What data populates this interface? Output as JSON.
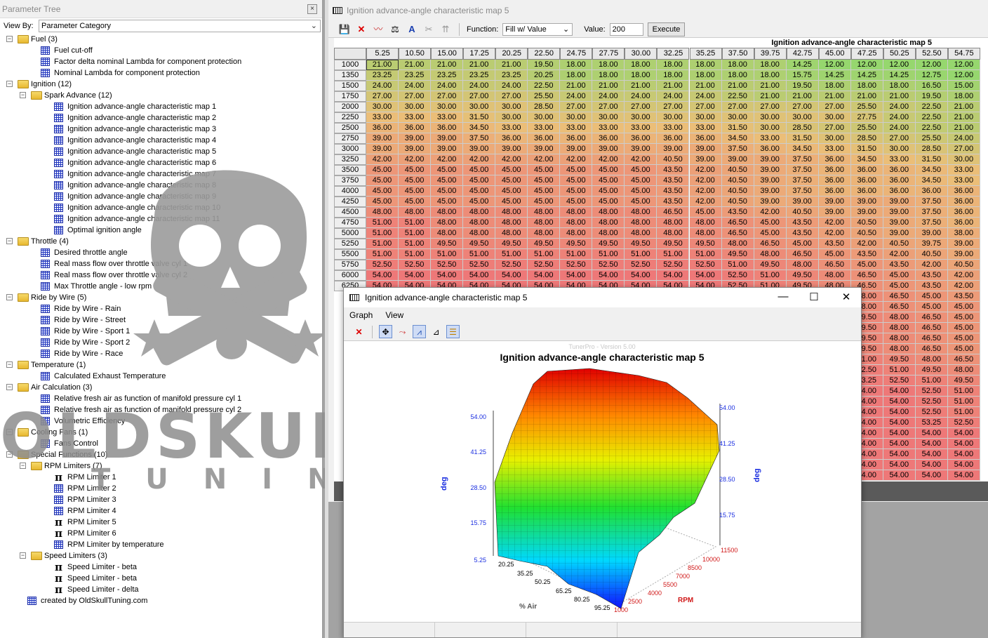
{
  "parameter_tree": {
    "title": "Parameter Tree",
    "close": "×",
    "view_by_label": "View By:",
    "view_by_value": "Parameter Category",
    "nodes": [
      {
        "label": "Fuel (3)",
        "type": "folder",
        "depth": 0
      },
      {
        "label": "Fuel cut-off",
        "type": "table",
        "depth": 1
      },
      {
        "label": "Factor delta nominal Lambda for component protection",
        "type": "table",
        "depth": 1
      },
      {
        "label": "Nominal Lambda for component protection",
        "type": "table",
        "depth": 1
      },
      {
        "label": "Ignition (12)",
        "type": "folder",
        "depth": 0
      },
      {
        "label": "Spark Advance (12)",
        "type": "folder",
        "depth": 1
      },
      {
        "label": "Ignition advance-angle characteristic map 1",
        "type": "table",
        "depth": 2
      },
      {
        "label": "Ignition advance-angle characteristic map 2",
        "type": "table",
        "depth": 2
      },
      {
        "label": "Ignition advance-angle characteristic map 3",
        "type": "table",
        "depth": 2
      },
      {
        "label": "Ignition advance-angle characteristic map 4",
        "type": "table",
        "depth": 2
      },
      {
        "label": "Ignition advance-angle characteristic map 5",
        "type": "table",
        "depth": 2
      },
      {
        "label": "Ignition advance-angle characteristic map 6",
        "type": "table",
        "depth": 2
      },
      {
        "label": "Ignition advance-angle characteristic map 7",
        "type": "table",
        "depth": 2
      },
      {
        "label": "Ignition advance-angle characteristic map 8",
        "type": "table",
        "depth": 2
      },
      {
        "label": "Ignition advance-angle characteristic map 9",
        "type": "table",
        "depth": 2
      },
      {
        "label": "Ignition advance-angle characteristic map 10",
        "type": "table",
        "depth": 2
      },
      {
        "label": "Ignition advance-angle characteristic map 11",
        "type": "table",
        "depth": 2
      },
      {
        "label": "Optimal ignition angle",
        "type": "table",
        "depth": 2
      },
      {
        "label": "Throttle (4)",
        "type": "folder",
        "depth": 0
      },
      {
        "label": "Desired throttle angle",
        "type": "table",
        "depth": 1
      },
      {
        "label": "Real mass flow over throttle valve cyl 1",
        "type": "table",
        "depth": 1
      },
      {
        "label": "Real mass flow over throttle valve cyl 2",
        "type": "table",
        "depth": 1
      },
      {
        "label": "Max Throttle angle - low rpm",
        "type": "table",
        "depth": 1
      },
      {
        "label": "Ride by Wire (5)",
        "type": "folder",
        "depth": 0
      },
      {
        "label": "Ride by Wire - Rain",
        "type": "table",
        "depth": 1
      },
      {
        "label": "Ride by Wire - Street",
        "type": "table",
        "depth": 1
      },
      {
        "label": "Ride by Wire - Sport 1",
        "type": "table",
        "depth": 1
      },
      {
        "label": "Ride by Wire - Sport 2",
        "type": "table",
        "depth": 1
      },
      {
        "label": "Ride by Wire - Race",
        "type": "table",
        "depth": 1
      },
      {
        "label": "Temperature (1)",
        "type": "folder",
        "depth": 0
      },
      {
        "label": "Calculated Exhaust Temperature",
        "type": "table",
        "depth": 1
      },
      {
        "label": "Air Calculation (3)",
        "type": "folder",
        "depth": 0
      },
      {
        "label": "Relative fresh air as function of manifold pressure cyl 1",
        "type": "table",
        "depth": 1
      },
      {
        "label": "Relative fresh air as function of manifold pressure cyl 2",
        "type": "table",
        "depth": 1
      },
      {
        "label": "Volumetric Efficiency",
        "type": "table",
        "depth": 1
      },
      {
        "label": "Cooling Fans (1)",
        "type": "folder",
        "depth": 0
      },
      {
        "label": "Fans Control",
        "type": "table",
        "depth": 1
      },
      {
        "label": "Special Functions (10)",
        "type": "folder",
        "depth": 0
      },
      {
        "label": "RPM Limiters (7)",
        "type": "folder",
        "depth": 1
      },
      {
        "label": "RPM Limiter 1",
        "type": "pi",
        "depth": 2
      },
      {
        "label": "RPM Limiter 2",
        "type": "table",
        "depth": 2
      },
      {
        "label": "RPM Limiter 3",
        "type": "table",
        "depth": 2
      },
      {
        "label": "RPM Limiter 4",
        "type": "table",
        "depth": 2
      },
      {
        "label": "RPM Limiter 5",
        "type": "pi",
        "depth": 2
      },
      {
        "label": "RPM Limiter 6",
        "type": "pi",
        "depth": 2
      },
      {
        "label": "RPM Limiter by temperature",
        "type": "table",
        "depth": 2
      },
      {
        "label": "Speed Limiters (3)",
        "type": "folder",
        "depth": 1
      },
      {
        "label": "Speed Limiter - beta",
        "type": "pi",
        "depth": 2
      },
      {
        "label": "Speed Limiter - beta",
        "type": "pi",
        "depth": 2
      },
      {
        "label": "Speed Limiter - delta",
        "type": "pi",
        "depth": 2
      },
      {
        "label": "created by OldSkullTuning.com",
        "type": "table",
        "depth": 0
      }
    ]
  },
  "watermark": {
    "line1": "OLDSKULL",
    "line2": "TUNING"
  },
  "map_window": {
    "title": "Ignition advance-angle characteristic map 5",
    "function_label": "Function:",
    "function_value": "Fill w/ Value",
    "value_label": "Value:",
    "value": "200",
    "execute_label": "Execute",
    "table_title": "Ignition advance-angle characteristic map 5",
    "columns": [
      "5.25",
      "10.50",
      "15.00",
      "17.25",
      "20.25",
      "22.50",
      "24.75",
      "27.75",
      "30.00",
      "32.25",
      "35.25",
      "37.50",
      "39.75",
      "42.75",
      "45.00",
      "47.25",
      "50.25",
      "52.50",
      "54.75"
    ],
    "rows": [
      {
        "rpm": "1000",
        "v": [
          "21.00",
          "21.00",
          "21.00",
          "21.00",
          "21.00",
          "19.50",
          "18.00",
          "18.00",
          "18.00",
          "18.00",
          "18.00",
          "18.00",
          "18.00",
          "14.25",
          "12.00",
          "12.00",
          "12.00",
          "12.00",
          "12.00"
        ]
      },
      {
        "rpm": "1350",
        "v": [
          "23.25",
          "23.25",
          "23.25",
          "23.25",
          "23.25",
          "20.25",
          "18.00",
          "18.00",
          "18.00",
          "18.00",
          "18.00",
          "18.00",
          "18.00",
          "15.75",
          "14.25",
          "14.25",
          "14.25",
          "12.75",
          "12.00"
        ]
      },
      {
        "rpm": "1500",
        "v": [
          "24.00",
          "24.00",
          "24.00",
          "24.00",
          "24.00",
          "22.50",
          "21.00",
          "21.00",
          "21.00",
          "21.00",
          "21.00",
          "21.00",
          "21.00",
          "19.50",
          "18.00",
          "18.00",
          "18.00",
          "16.50",
          "15.00"
        ]
      },
      {
        "rpm": "1750",
        "v": [
          "27.00",
          "27.00",
          "27.00",
          "27.00",
          "27.00",
          "25.50",
          "24.00",
          "24.00",
          "24.00",
          "24.00",
          "24.00",
          "22.50",
          "21.00",
          "21.00",
          "21.00",
          "21.00",
          "21.00",
          "19.50",
          "18.00"
        ]
      },
      {
        "rpm": "2000",
        "v": [
          "30.00",
          "30.00",
          "30.00",
          "30.00",
          "30.00",
          "28.50",
          "27.00",
          "27.00",
          "27.00",
          "27.00",
          "27.00",
          "27.00",
          "27.00",
          "27.00",
          "27.00",
          "25.50",
          "24.00",
          "22.50",
          "21.00"
        ]
      },
      {
        "rpm": "2250",
        "v": [
          "33.00",
          "33.00",
          "33.00",
          "31.50",
          "30.00",
          "30.00",
          "30.00",
          "30.00",
          "30.00",
          "30.00",
          "30.00",
          "30.00",
          "30.00",
          "30.00",
          "30.00",
          "27.75",
          "24.00",
          "22.50",
          "21.00"
        ]
      },
      {
        "rpm": "2500",
        "v": [
          "36.00",
          "36.00",
          "36.00",
          "34.50",
          "33.00",
          "33.00",
          "33.00",
          "33.00",
          "33.00",
          "33.00",
          "33.00",
          "31.50",
          "30.00",
          "28.50",
          "27.00",
          "25.50",
          "24.00",
          "22.50",
          "21.00"
        ]
      },
      {
        "rpm": "2750",
        "v": [
          "39.00",
          "39.00",
          "39.00",
          "37.50",
          "36.00",
          "36.00",
          "36.00",
          "36.00",
          "36.00",
          "36.00",
          "36.00",
          "34.50",
          "33.00",
          "31.50",
          "30.00",
          "28.50",
          "27.00",
          "25.50",
          "24.00"
        ]
      },
      {
        "rpm": "3000",
        "v": [
          "39.00",
          "39.00",
          "39.00",
          "39.00",
          "39.00",
          "39.00",
          "39.00",
          "39.00",
          "39.00",
          "39.00",
          "39.00",
          "37.50",
          "36.00",
          "34.50",
          "33.00",
          "31.50",
          "30.00",
          "28.50",
          "27.00"
        ]
      },
      {
        "rpm": "3250",
        "v": [
          "42.00",
          "42.00",
          "42.00",
          "42.00",
          "42.00",
          "42.00",
          "42.00",
          "42.00",
          "42.00",
          "40.50",
          "39.00",
          "39.00",
          "39.00",
          "37.50",
          "36.00",
          "34.50",
          "33.00",
          "31.50",
          "30.00"
        ]
      },
      {
        "rpm": "3500",
        "v": [
          "45.00",
          "45.00",
          "45.00",
          "45.00",
          "45.00",
          "45.00",
          "45.00",
          "45.00",
          "45.00",
          "43.50",
          "42.00",
          "40.50",
          "39.00",
          "37.50",
          "36.00",
          "36.00",
          "36.00",
          "34.50",
          "33.00"
        ]
      },
      {
        "rpm": "3750",
        "v": [
          "45.00",
          "45.00",
          "45.00",
          "45.00",
          "45.00",
          "45.00",
          "45.00",
          "45.00",
          "45.00",
          "43.50",
          "42.00",
          "40.50",
          "39.00",
          "37.50",
          "36.00",
          "36.00",
          "36.00",
          "34.50",
          "33.00"
        ]
      },
      {
        "rpm": "4000",
        "v": [
          "45.00",
          "45.00",
          "45.00",
          "45.00",
          "45.00",
          "45.00",
          "45.00",
          "45.00",
          "45.00",
          "43.50",
          "42.00",
          "40.50",
          "39.00",
          "37.50",
          "36.00",
          "36.00",
          "36.00",
          "36.00",
          "36.00"
        ]
      },
      {
        "rpm": "4250",
        "v": [
          "45.00",
          "45.00",
          "45.00",
          "45.00",
          "45.00",
          "45.00",
          "45.00",
          "45.00",
          "45.00",
          "43.50",
          "42.00",
          "40.50",
          "39.00",
          "39.00",
          "39.00",
          "39.00",
          "39.00",
          "37.50",
          "36.00"
        ]
      },
      {
        "rpm": "4500",
        "v": [
          "48.00",
          "48.00",
          "48.00",
          "48.00",
          "48.00",
          "48.00",
          "48.00",
          "48.00",
          "48.00",
          "46.50",
          "45.00",
          "43.50",
          "42.00",
          "40.50",
          "39.00",
          "39.00",
          "39.00",
          "37.50",
          "36.00"
        ]
      },
      {
        "rpm": "4750",
        "v": [
          "51.00",
          "51.00",
          "48.00",
          "48.00",
          "48.00",
          "48.00",
          "48.00",
          "48.00",
          "48.00",
          "48.00",
          "48.00",
          "46.50",
          "45.00",
          "43.50",
          "42.00",
          "40.50",
          "39.00",
          "37.50",
          "36.00"
        ]
      },
      {
        "rpm": "5000",
        "v": [
          "51.00",
          "51.00",
          "48.00",
          "48.00",
          "48.00",
          "48.00",
          "48.00",
          "48.00",
          "48.00",
          "48.00",
          "48.00",
          "46.50",
          "45.00",
          "43.50",
          "42.00",
          "40.50",
          "39.00",
          "39.00",
          "38.00"
        ]
      },
      {
        "rpm": "5250",
        "v": [
          "51.00",
          "51.00",
          "49.50",
          "49.50",
          "49.50",
          "49.50",
          "49.50",
          "49.50",
          "49.50",
          "49.50",
          "49.50",
          "48.00",
          "46.50",
          "45.00",
          "43.50",
          "42.00",
          "40.50",
          "39.75",
          "39.00"
        ]
      },
      {
        "rpm": "5500",
        "v": [
          "51.00",
          "51.00",
          "51.00",
          "51.00",
          "51.00",
          "51.00",
          "51.00",
          "51.00",
          "51.00",
          "51.00",
          "51.00",
          "49.50",
          "48.00",
          "46.50",
          "45.00",
          "43.50",
          "42.00",
          "40.50",
          "39.00"
        ]
      },
      {
        "rpm": "5750",
        "v": [
          "52.50",
          "52.50",
          "52.50",
          "52.50",
          "52.50",
          "52.50",
          "52.50",
          "52.50",
          "52.50",
          "52.50",
          "52.50",
          "51.00",
          "49.50",
          "48.00",
          "46.50",
          "45.00",
          "43.50",
          "42.00",
          "40.50"
        ]
      },
      {
        "rpm": "6000",
        "v": [
          "54.00",
          "54.00",
          "54.00",
          "54.00",
          "54.00",
          "54.00",
          "54.00",
          "54.00",
          "54.00",
          "54.00",
          "54.00",
          "52.50",
          "51.00",
          "49.50",
          "48.00",
          "46.50",
          "45.00",
          "43.50",
          "42.00"
        ]
      },
      {
        "rpm": "6250",
        "v": [
          "54.00",
          "54.00",
          "54.00",
          "54.00",
          "54.00",
          "54.00",
          "54.00",
          "54.00",
          "54.00",
          "54.00",
          "54.00",
          "52.50",
          "51.00",
          "49.50",
          "48.00",
          "46.50",
          "45.00",
          "43.50",
          "42.00"
        ]
      }
    ],
    "right_cols": [
      [
        "48.00",
        "46.50",
        "45.00",
        "43.50"
      ],
      [
        "48.00",
        "46.50",
        "45.00",
        "45.00"
      ],
      [
        "49.50",
        "48.00",
        "46.50",
        "45.00"
      ],
      [
        "49.50",
        "48.00",
        "46.50",
        "45.00"
      ],
      [
        "49.50",
        "48.00",
        "46.50",
        "45.00"
      ],
      [
        "49.50",
        "48.00",
        "46.50",
        "45.00"
      ],
      [
        "51.00",
        "49.50",
        "48.00",
        "46.50"
      ],
      [
        "52.50",
        "51.00",
        "49.50",
        "48.00"
      ],
      [
        "53.25",
        "52.50",
        "51.00",
        "49.50"
      ],
      [
        "54.00",
        "54.00",
        "52.50",
        "51.00"
      ],
      [
        "54.00",
        "54.00",
        "52.50",
        "51.00"
      ],
      [
        "54.00",
        "54.00",
        "52.50",
        "51.00"
      ],
      [
        "54.00",
        "54.00",
        "53.25",
        "52.50"
      ],
      [
        "54.00",
        "54.00",
        "54.00",
        "54.00"
      ],
      [
        "54.00",
        "54.00",
        "54.00",
        "54.00"
      ],
      [
        "54.00",
        "54.00",
        "54.00",
        "54.00"
      ],
      [
        "54.00",
        "54.00",
        "54.00",
        "54.00"
      ],
      [
        "54.00",
        "54.00",
        "54.00",
        "54.00"
      ]
    ]
  },
  "graph_window": {
    "title": "Ignition advance-angle characteristic map 5",
    "menu": [
      "Graph",
      "View"
    ],
    "watermark": "TunerPro - Version 5.00",
    "chart_title": "Ignition advance-angle characteristic map 5",
    "z_ticks_left": [
      "54.00",
      "41.25",
      "28.50",
      "15.75",
      "5.25"
    ],
    "z_ticks_right": [
      "54.00",
      "41.25",
      "28.50",
      "15.75"
    ],
    "z_label": "deg",
    "air_ticks": [
      "20.25",
      "35.25",
      "50.25",
      "65.25",
      "80.25",
      "95.25"
    ],
    "air_label": "% Air",
    "rpm_ticks": [
      "11500",
      "10000",
      "8500",
      "7000",
      "5500",
      "4000",
      "2500",
      "1000"
    ],
    "rpm_label": "RPM"
  }
}
